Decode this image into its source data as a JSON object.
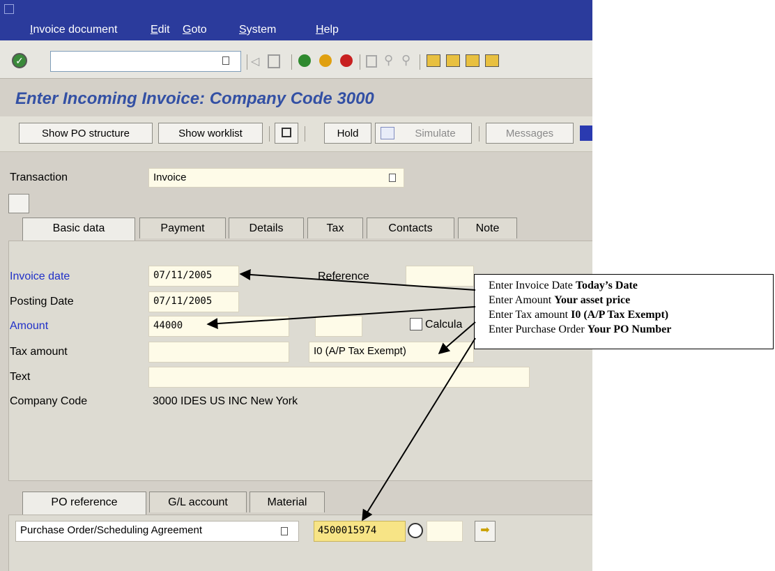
{
  "menu": [
    "Invoice document",
    "Edit",
    "Goto",
    "System",
    "Help"
  ],
  "title": "Enter Incoming Invoice: Company Code 3000",
  "app_toolbar": {
    "show_po_structure": "Show PO structure",
    "show_worklist": "Show worklist",
    "hold": "Hold",
    "simulate": "Simulate",
    "messages": "Messages"
  },
  "transaction": {
    "label": "Transaction",
    "value": "Invoice"
  },
  "tabs_top": [
    "Basic data",
    "Payment",
    "Details",
    "Tax",
    "Contacts",
    "Note"
  ],
  "basic": {
    "invoice_date_label": "Invoice date",
    "invoice_date": "07/11/2005",
    "reference_label": "Reference",
    "posting_date_label": "Posting Date",
    "posting_date": "07/11/2005",
    "amount_label": "Amount",
    "amount": "44000",
    "calculate_label": "Calcula",
    "tax_amount_label": "Tax amount",
    "tax_code": "I0 (A/P Tax Exempt)",
    "text_label": "Text",
    "company_code_label": "Company Code",
    "company_code": "3000 IDES US INC New York"
  },
  "tabs_bottom": [
    "PO reference",
    "G/L account",
    "Material"
  ],
  "po": {
    "label": "Purchase Order/Scheduling Agreement",
    "value": "4500015974"
  },
  "callout": {
    "line1_prefix": "Enter Invoice Date ",
    "line1_bold": "Today’s Date",
    "line2_prefix": "Enter Amount ",
    "line2_bold": "Your asset price",
    "line3_prefix": "Enter Tax amount ",
    "line3_bold": "I0 (A/P Tax Exempt)",
    "line4_prefix": "Enter Purchase Order ",
    "line4_bold": "Your PO Number"
  },
  "colors": {
    "menubar": "#2b3b9c",
    "title": "#3350a4",
    "required_label": "#2030c8",
    "field_bg": "#fefbe8"
  }
}
